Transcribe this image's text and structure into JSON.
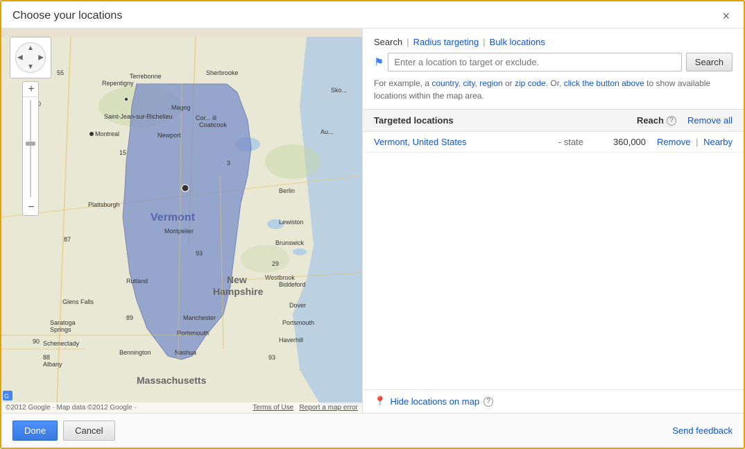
{
  "dialog": {
    "title": "Choose your locations",
    "close_label": "×"
  },
  "tabs": {
    "search_label": "Search",
    "radius_label": "Radius targeting",
    "bulk_label": "Bulk locations",
    "separator": "|"
  },
  "search": {
    "placeholder": "Enter a location to target or exclude.",
    "button_label": "Search",
    "hint": "For example, a country, city, region or zip code. Or, click the button above to show available locations within the map area."
  },
  "targeted": {
    "header_label": "Targeted locations",
    "reach_label": "Reach",
    "help_icon": "?",
    "remove_all_label": "Remove all"
  },
  "locations": [
    {
      "name": "Vermont, United States",
      "type": "- state",
      "reach": "360,000",
      "remove_label": "Remove",
      "nearby_label": "Nearby"
    }
  ],
  "map_bottom": {
    "hide_label": "Hide locations on map",
    "help_icon": "?"
  },
  "footer": {
    "done_label": "Done",
    "cancel_label": "Cancel",
    "feedback_label": "Send feedback"
  },
  "map": {
    "copyright": "©2012 Google · Map data ©2012 Google ·",
    "terms_label": "Terms of Use",
    "report_label": "Report a map error"
  },
  "pan_arrows": {
    "up": "▲",
    "down": "▼",
    "left": "◀",
    "right": "▶"
  },
  "zoom": {
    "plus": "+",
    "minus": "−"
  }
}
